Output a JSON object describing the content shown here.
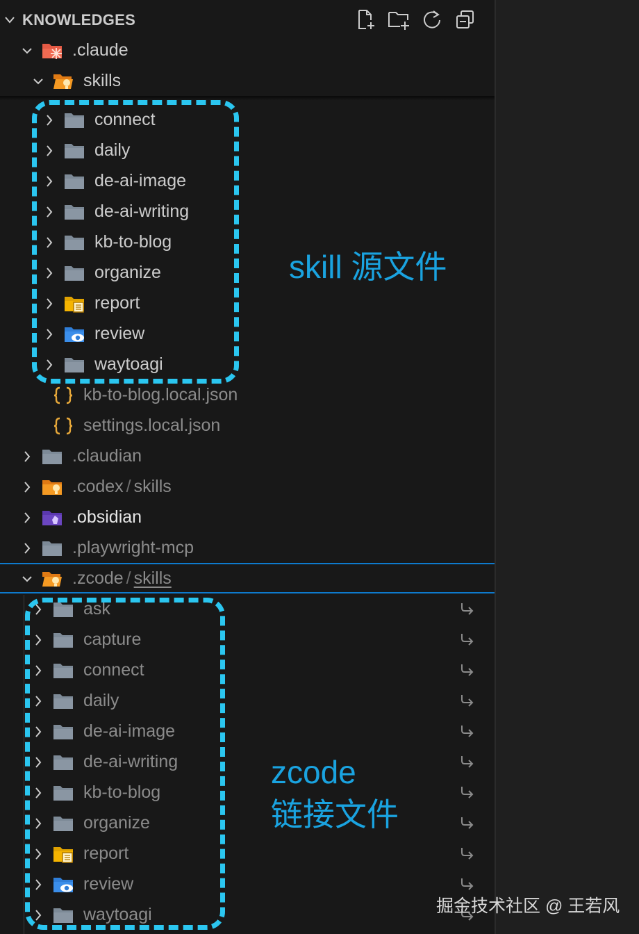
{
  "explorer": {
    "title": "KNOWLEDGES",
    "header_actions": [
      "new-file-icon",
      "new-folder-icon",
      "refresh-icon",
      "collapse-all-icon"
    ],
    "claude": {
      "name": ".claude",
      "skills_folder": "skills",
      "skills": [
        "connect",
        "daily",
        "de-ai-image",
        "de-ai-writing",
        "kb-to-blog",
        "organize",
        "report",
        "review",
        "waytoagi"
      ],
      "files": [
        "kb-to-blog.local.json",
        "settings.local.json"
      ]
    },
    "root_folders": {
      "claudian": ".claudian",
      "codex": ".codex",
      "codex_sub": "skills",
      "obsidian": ".obsidian",
      "playwright": ".playwright-mcp",
      "zcode": ".zcode",
      "zcode_sub": "skills"
    },
    "zcode_skills": [
      "ask",
      "capture",
      "connect",
      "daily",
      "de-ai-image",
      "de-ai-writing",
      "kb-to-blog",
      "organize",
      "report",
      "review",
      "waytoagi"
    ],
    "path_separator": "/"
  },
  "annotations": {
    "source": "skill 源文件",
    "link_line1": "zcode",
    "link_line2": "链接文件"
  },
  "watermark": "掘金技术社区 @ 王若风",
  "colors": {
    "accent_dash": "#2bc6f0",
    "annotation_text": "#1aa3e0",
    "selection_border": "#0e7acd",
    "folder_grey": "#8a96a3",
    "folder_orange": "#f28c28",
    "folder_yellow": "#f5b400",
    "folder_blue": "#3b8eea",
    "folder_purple": "#6b46c1",
    "json_brace": "#e8a93a"
  }
}
